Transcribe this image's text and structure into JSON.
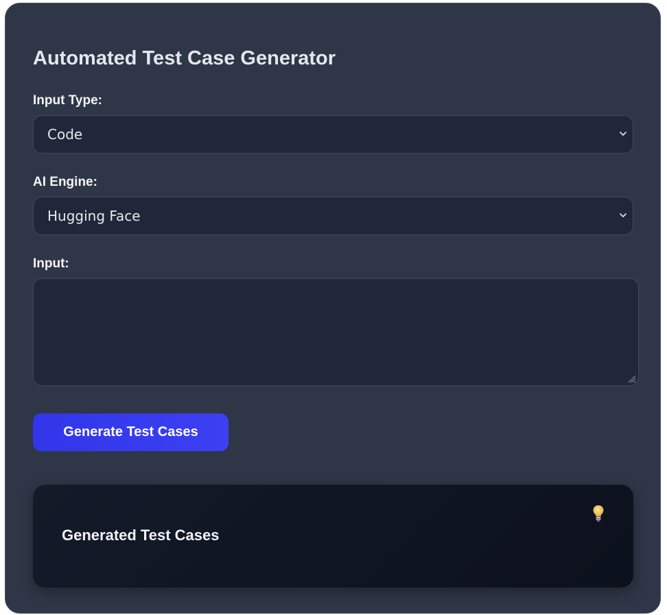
{
  "app": {
    "title": "Automated Test Case Generator"
  },
  "form": {
    "input_type": {
      "label": "Input Type:",
      "selected": "Code"
    },
    "ai_engine": {
      "label": "AI Engine:",
      "selected": "Hugging Face"
    },
    "input": {
      "label": "Input:",
      "value": ""
    },
    "generate_button_label": "Generate Test Cases"
  },
  "output": {
    "title": "Generated Test Cases",
    "icon": "lightbulb-icon"
  },
  "colors": {
    "background": "#2f3647",
    "field": "#1f2738",
    "button": "#3a3ef0",
    "output_panel": "#101623"
  }
}
